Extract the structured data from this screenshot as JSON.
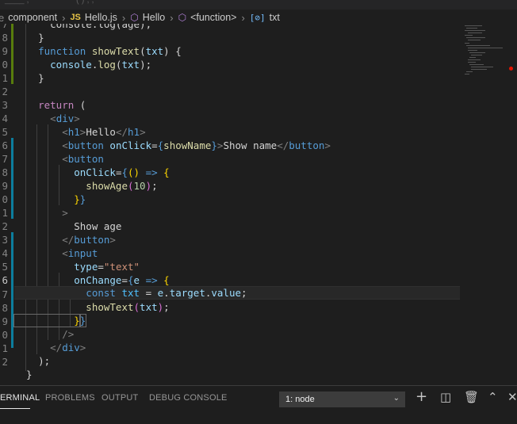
{
  "breadcrumb": {
    "folder": "component",
    "file_badge": "JS",
    "file": "Hello.js",
    "component": "Hello",
    "function": "<function>",
    "variable": "txt"
  },
  "editor": {
    "line_numbers": [
      "7",
      "8",
      "9",
      "0",
      "1",
      "2",
      "3",
      "4",
      "5",
      "6",
      "7",
      "8",
      "9",
      "0",
      "1",
      "2",
      "3",
      "4",
      "5",
      "6",
      "7",
      "8",
      "9",
      "0",
      "1",
      "2"
    ],
    "cursor_line_index": 19
  },
  "panel": {
    "tabs": [
      "ERMINAL",
      "PROBLEMS",
      "OUTPUT",
      "DEBUG CONSOLE"
    ],
    "terminal_select": "1: node",
    "icons": [
      "plus-icon",
      "split-icon",
      "trash-icon",
      "chevron-up-icon",
      "close-icon"
    ]
  }
}
